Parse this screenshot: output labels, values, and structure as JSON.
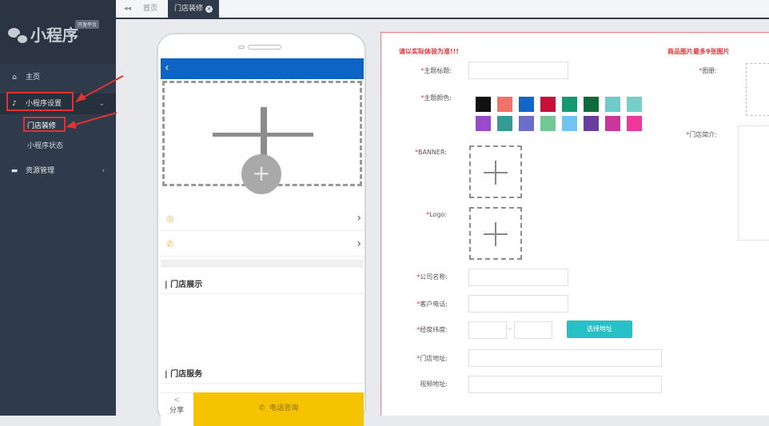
{
  "sidebar": {
    "brand_title": "小程序",
    "brand_tag": "开发平台",
    "items": [
      {
        "label": "主页",
        "icon": "home-icon"
      },
      {
        "label": "小程序设置",
        "icon": "tiktok-icon"
      },
      {
        "label": "门店装修"
      },
      {
        "label": "小程序状态"
      },
      {
        "label": "资源管理",
        "icon": "folder-icon"
      }
    ]
  },
  "topbar": {
    "back": "◂◂",
    "tabs": [
      {
        "label": "首页"
      },
      {
        "label": "门店装修"
      }
    ]
  },
  "phone": {
    "back_glyph": "‹",
    "section_show": "| 门店展示",
    "section_service": "| 门店服务",
    "share_label": "分享",
    "call_label": "电话咨询"
  },
  "form": {
    "warn_left": "请以实际体验为准!!!",
    "warn_right": "商品图片最多9张图片",
    "labels": {
      "theme_title": "主题标题:",
      "theme_color": "主题颜色:",
      "banner": "BANNER:",
      "logo": "Logo:",
      "company": "公司名称:",
      "phone": "客户电话:",
      "lnglat": "经度纬度:",
      "address": "门店地址:",
      "video": "视频地址:",
      "album": "图册:",
      "intro": "门店简介:"
    },
    "lnglat_sep": "--",
    "select_address_button": "选择地址",
    "colors": [
      "#111111",
      "#f0726b",
      "#1366c7",
      "#c9103d",
      "#139a6e",
      "#0f6b3a",
      "#6fcac8",
      "#73d1c9",
      "#9b4bc9",
      "#379a95",
      "#6b6fc9",
      "#73c795",
      "#73c3f0",
      "#6a3ea0",
      "#c8379c",
      "#f0379c"
    ]
  }
}
